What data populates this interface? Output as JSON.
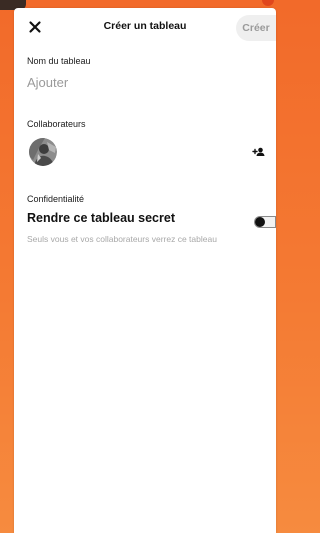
{
  "header": {
    "title": "Créer un tableau",
    "create_label": "Créer",
    "close_icon": "close-icon"
  },
  "board_name": {
    "label": "Nom du tableau",
    "placeholder": "Ajouter",
    "value": ""
  },
  "collaborators": {
    "label": "Collaborateurs",
    "avatar_icon": "avatar",
    "add_icon": "add-person-icon"
  },
  "privacy": {
    "label": "Confidentialité",
    "secret_title": "Rendre ce tableau secret",
    "secret_description": "Seuls vous et vos collaborateurs verrez ce tableau",
    "secret_enabled": false
  },
  "colors": {
    "background_top": "#f26a2a",
    "background_bottom": "#f68b3f",
    "create_button_bg": "#efefef",
    "create_button_text": "#9a9a9a"
  }
}
